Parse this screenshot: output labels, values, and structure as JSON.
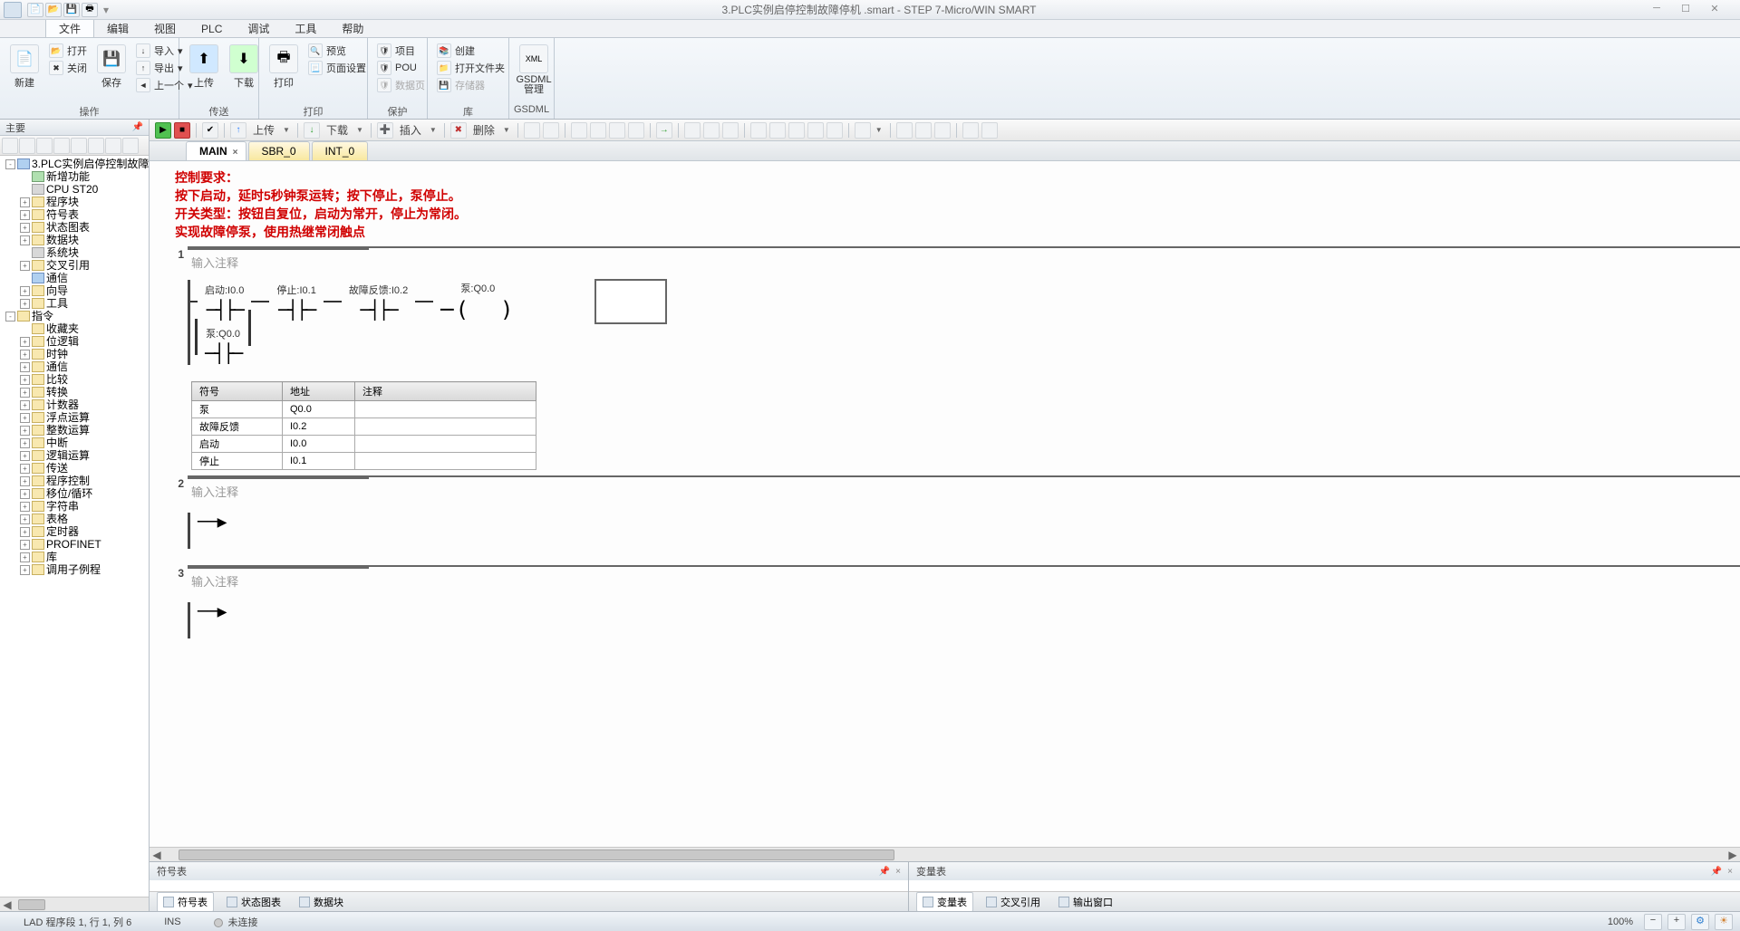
{
  "window": {
    "title": "3.PLC实例启停控制故障停机 .smart - STEP 7-Micro/WIN SMART"
  },
  "menu": {
    "file": "文件",
    "edit": "编辑",
    "view": "视图",
    "plc": "PLC",
    "debug": "调试",
    "tools": "工具",
    "help": "帮助"
  },
  "ribbon": {
    "group_operate": "操作",
    "group_transfer": "传送",
    "group_print": "打印",
    "group_protect": "保护",
    "group_library": "库",
    "group_gsdml": "GSDML",
    "new": "新建",
    "open": "打开",
    "close": "关闭",
    "import": "导入",
    "export": "导出",
    "previous": "上一个",
    "save": "保存",
    "upload": "上传",
    "download": "下载",
    "print": "打印",
    "preview": "预览",
    "page_setup": "页面设置",
    "project": "项目",
    "pou": "POU",
    "data_page": "数据页",
    "create": "创建",
    "open_folder": "打开文件夹",
    "memory": "存储器",
    "gsdml_manage": "GSDML\n管理"
  },
  "left_panel": {
    "title": "主要",
    "project_root": "3.PLC实例启停控制故障停机",
    "items1": [
      "新增功能",
      "CPU ST20",
      "程序块",
      "符号表",
      "状态图表",
      "数据块",
      "系统块",
      "交叉引用",
      "通信",
      "向导",
      "工具"
    ],
    "instruction_root": "指令",
    "items2": [
      "收藏夹",
      "位逻辑",
      "时钟",
      "通信",
      "比较",
      "转换",
      "计数器",
      "浮点运算",
      "整数运算",
      "中断",
      "逻辑运算",
      "传送",
      "程序控制",
      "移位/循环",
      "字符串",
      "表格",
      "定时器",
      "PROFINET",
      "库",
      "调用子例程"
    ]
  },
  "editor": {
    "toolbar": {
      "upload": "上传",
      "download": "下载",
      "insert": "插入",
      "delete": "删除"
    },
    "tabs": {
      "main": "MAIN",
      "sbr0": "SBR_0",
      "int0": "INT_0"
    },
    "header": {
      "line1": "控制要求：",
      "line2": "按下启动，延时5秒钟泵运转；按下停止，泵停止。",
      "line3": "开关类型：按钮自复位，启动为常开，停止为常闭。",
      "line4": "实现故障停泵，使用热继常闭触点"
    },
    "network1": {
      "num": "1",
      "comment": "输入注释",
      "c1_label": "启动:I0.0",
      "c2_label": "停止:I0.1",
      "c3_label": "故障反馈:I0.2",
      "coil_label": "泵:Q0.0",
      "branch_label": "泵:Q0.0"
    },
    "symtable": {
      "h1": "符号",
      "h2": "地址",
      "h3": "注释",
      "r1c1": "泵",
      "r1c2": "Q0.0",
      "r2c1": "故障反馈",
      "r2c2": "I0.2",
      "r3c1": "启动",
      "r3c2": "I0.0",
      "r4c1": "停止",
      "r4c2": "I0.1"
    },
    "network2": {
      "num": "2",
      "comment": "输入注释"
    },
    "network3": {
      "num": "3",
      "comment": "输入注释"
    }
  },
  "bottom": {
    "left_title": "符号表",
    "right_title": "变量表",
    "tab_symbol": "符号表",
    "tab_status": "状态图表",
    "tab_data": "数据块",
    "tab_var": "变量表",
    "tab_xref": "交叉引用",
    "tab_output": "输出窗口"
  },
  "status": {
    "pos": "LAD 程序段 1, 行 1, 列 6",
    "ins": "INS",
    "conn": "未连接",
    "zoom": "100%"
  }
}
